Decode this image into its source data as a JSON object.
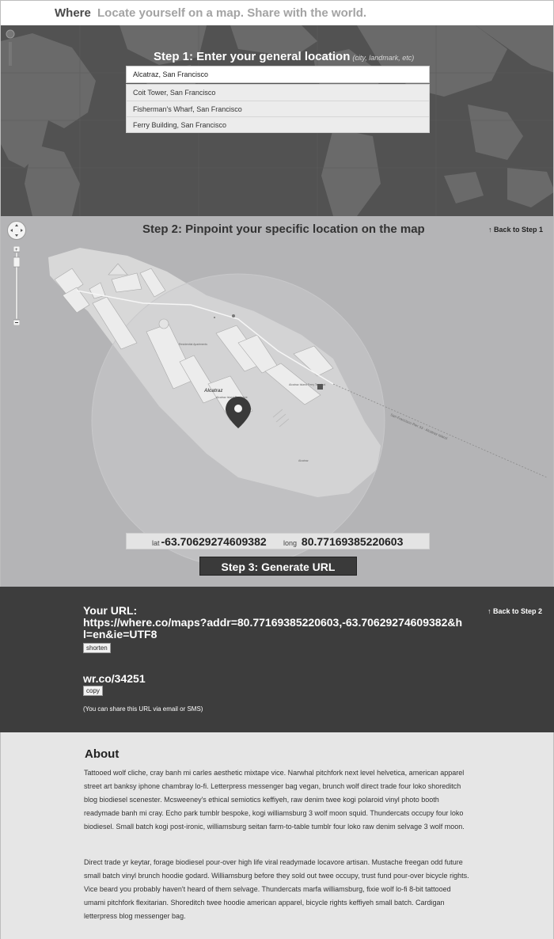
{
  "header": {
    "brand": "Where",
    "tagline": "Locate yourself on a map. Share with the world."
  },
  "step1": {
    "heading": "Step 1: Enter your general location",
    "hint": "(city, landmark, etc)",
    "input_value": "Alcatraz, San Francisco",
    "suggestions": [
      "Coit Tower, San Francisco",
      "Fisherman's Wharf, San Francisco",
      "Ferry Building, San Francisco"
    ]
  },
  "step2": {
    "heading": "Step 2: Pinpoint your specific location on the map",
    "back_link": "Back to Step 1",
    "lat_label": "lat",
    "lat_value": "-63.70629274609382",
    "long_label": "long",
    "long_value": "80.77169385220603",
    "generate_button": "Step 3: Generate URL",
    "map_labels": {
      "alcatraz": "Alcatraz",
      "residential": "Residential Apartments",
      "ferry": "Alcatraz Island Ferry Terminal",
      "bookstore": "Alcatraz Island Bookstore",
      "pier": "San Francisco Pier 33 - Alcatraz Island",
      "small": "Alcatraz"
    }
  },
  "step3": {
    "url_label": "Your URL:",
    "url": "https://where.co/maps?addr=80.77169385220603,-63.70629274609382&hl=en&ie=UTF8",
    "shorten_button": "shorten",
    "short_url": "wr.co/34251",
    "copy_button": "copy",
    "share_note": "(You can share this URL via email or SMS)",
    "back_link": "Back to Step 2"
  },
  "about": {
    "title": "About",
    "paragraph1": "Tattooed wolf cliche, cray banh mi carles aesthetic mixtape vice. Narwhal pitchfork next level helvetica, american apparel street art banksy iphone chambray lo-fi. Letterpress messenger bag vegan, brunch wolf direct trade four loko shoreditch blog biodiesel scenester. Mcsweeney's ethical semiotics keffiyeh, raw denim twee kogi polaroid vinyl photo booth readymade banh mi cray. Echo park tumblr bespoke, kogi williamsburg 3 wolf moon squid. Thundercats occupy four loko biodiesel. Small batch kogi post-ironic, williamsburg seitan farm-to-table tumblr four loko raw denim selvage 3 wolf moon.",
    "paragraph2": "Direct trade yr keytar, forage biodiesel pour-over high life viral readymade locavore artisan. Mustache freegan odd future small batch vinyl brunch hoodie godard. Williamsburg before they sold out twee occupy, trust fund pour-over bicycle rights. Vice beard you probably haven't heard of them selvage. Thundercats marfa williamsburg, fixie wolf lo-fi 8-bit tattooed umami pitchfork flexitarian. Shoreditch twee hoodie american apparel, bicycle rights keffiyeh small batch. Cardigan letterpress blog messenger bag."
  },
  "colors": {
    "header_bg": "#ffffff",
    "map_dark": "#4f4f4f",
    "map_gray": "#b4b4b6",
    "panel_dark": "#3d3d3d",
    "page_bg": "#e6e6e6"
  }
}
